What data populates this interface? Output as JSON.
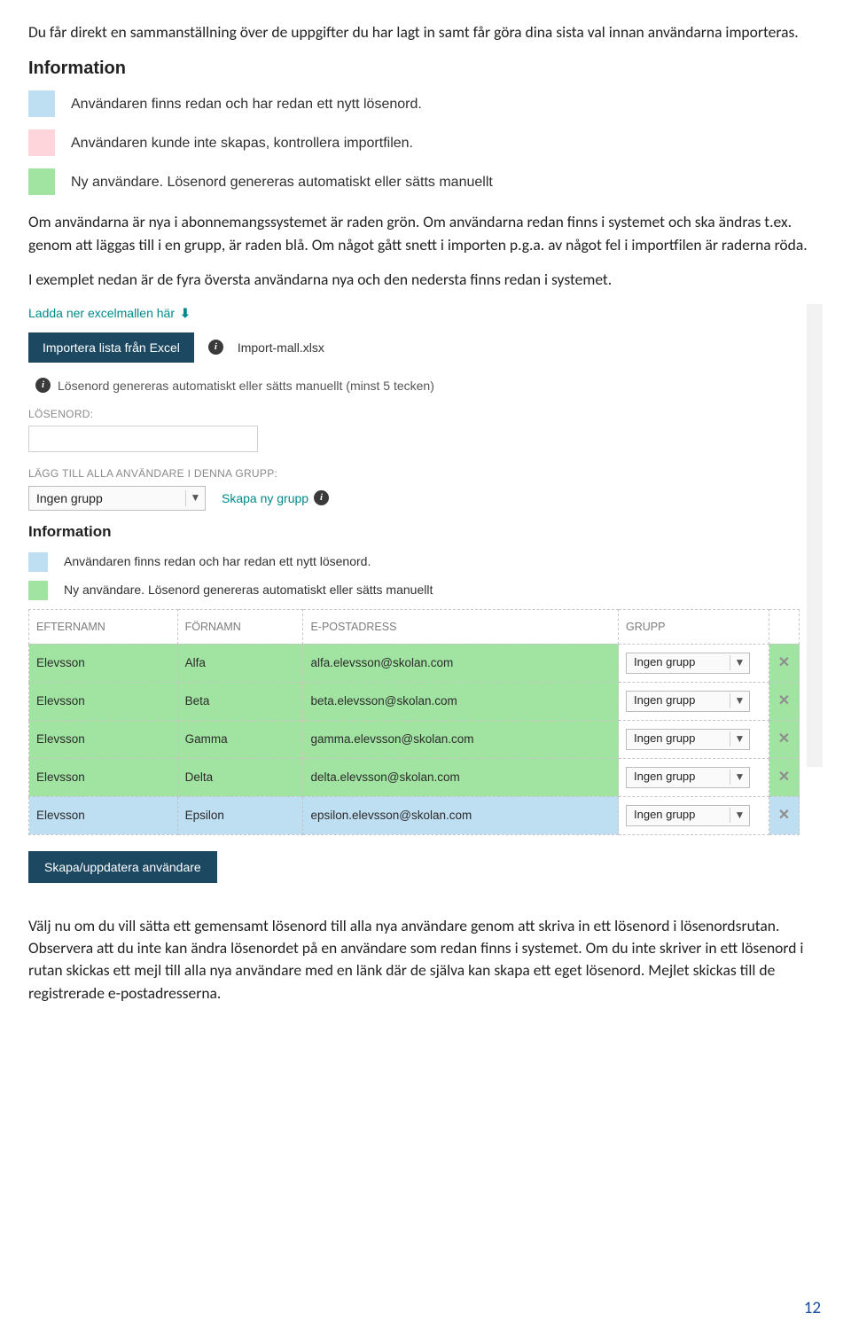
{
  "paragraphs": {
    "p1": "Du får direkt en sammanställning över de uppgifter du har lagt in samt får göra dina sista val innan användarna importeras.",
    "p2": "Om användarna är nya i abonnemangssystemet är raden grön. Om användarna redan finns i systemet och ska ändras t.ex. genom att läggas till i en grupp, är raden blå. Om något gått snett i importen p.g.a. av något fel i importfilen är raderna röda.",
    "p3": "I exemplet nedan är de fyra översta användarna nya och den nedersta finns redan i systemet.",
    "p4": "Välj nu om du vill sätta ett gemensamt lösenord till alla nya användare genom att skriva in ett lösenord i lösenordsrutan. Observera att du inte kan ändra lösenordet på en användare som redan finns i systemet. Om du inte skriver in ett lösenord i rutan skickas ett mejl till alla nya användare med en länk där de själva kan skapa ett eget lösenord. Mejlet skickas till de registrerade e-postadresserna."
  },
  "info1": {
    "title": "Information",
    "blue": "Användaren finns redan och har redan ett nytt lösenord.",
    "pink": "Användaren kunde inte skapas, kontrollera importfilen.",
    "green": "Ny användare. Lösenord genereras automatiskt eller sätts manuellt"
  },
  "ui": {
    "download_link": "Ladda ner excelmallen här",
    "import_btn": "Importera lista från Excel",
    "import_file": "Import-mall.xlsx",
    "pw_hint": "Lösenord genereras automatiskt eller sätts manuellt (minst 5 tecken)",
    "pw_label": "LÖSENORD:",
    "group_label": "LÄGG TILL ALLA ANVÄNDARE I DENNA GRUPP:",
    "group_select_value": "Ingen grupp",
    "create_group": "Skapa ny grupp",
    "info_title": "Information",
    "legend_blue": "Användaren finns redan och har redan ett nytt lösenord.",
    "legend_green": "Ny användare. Lösenord genereras automatiskt eller sätts manuellt",
    "submit_btn": "Skapa/uppdatera användare"
  },
  "table": {
    "headers": {
      "lastname": "EFTERNAMN",
      "firstname": "FÖRNAMN",
      "email": "E-POSTADRESS",
      "group": "GRUPP"
    },
    "group_value": "Ingen grupp",
    "rows": [
      {
        "status": "green",
        "lastname": "Elevsson",
        "firstname": "Alfa",
        "email": "alfa.elevsson@skolan.com"
      },
      {
        "status": "green",
        "lastname": "Elevsson",
        "firstname": "Beta",
        "email": "beta.elevsson@skolan.com"
      },
      {
        "status": "green",
        "lastname": "Elevsson",
        "firstname": "Gamma",
        "email": "gamma.elevsson@skolan.com"
      },
      {
        "status": "green",
        "lastname": "Elevsson",
        "firstname": "Delta",
        "email": "delta.elevsson@skolan.com"
      },
      {
        "status": "blue",
        "lastname": "Elevsson",
        "firstname": "Epsilon",
        "email": "epsilon.elevsson@skolan.com"
      }
    ]
  },
  "page_number": "12"
}
